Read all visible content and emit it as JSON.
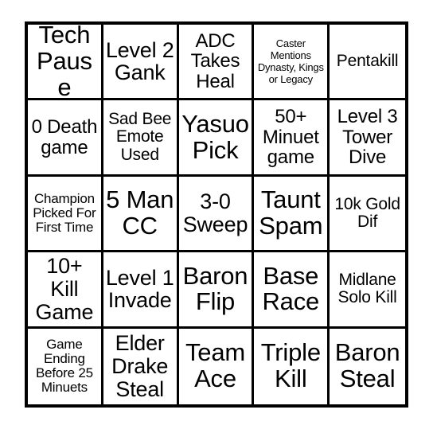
{
  "card": {
    "type": "bingo-card",
    "columns": 5,
    "rows": 5,
    "border_color": "#000000",
    "background_color": "#ffffff",
    "text_color": "#000000",
    "cells": [
      {
        "text": "Tech Pause",
        "size": "xxl"
      },
      {
        "text": "Level 2 Gank",
        "size": "xl"
      },
      {
        "text": "ADC Takes Heal",
        "size": "l"
      },
      {
        "text": "Caster Mentions Dynasty, Kings or Legacy",
        "size": "xs"
      },
      {
        "text": "Pentakill",
        "size": "m"
      },
      {
        "text": "0 Death game",
        "size": "l"
      },
      {
        "text": "Sad Bee Emote Used",
        "size": "m"
      },
      {
        "text": "Yasuo Pick",
        "size": "xxl"
      },
      {
        "text": "50+ Minuet game",
        "size": "l"
      },
      {
        "text": "Level 3 Tower Dive",
        "size": "l"
      },
      {
        "text": "Champion Picked For First Time",
        "size": "s"
      },
      {
        "text": "5 Man CC",
        "size": "xxl"
      },
      {
        "text": "3-0 Sweep",
        "size": "xl"
      },
      {
        "text": "Taunt Spam",
        "size": "xxl"
      },
      {
        "text": "10k Gold Dif",
        "size": "m"
      },
      {
        "text": "10+ Kill Game",
        "size": "xl"
      },
      {
        "text": "Level 1 Invade",
        "size": "xl"
      },
      {
        "text": "Baron Flip",
        "size": "xxl"
      },
      {
        "text": "Base Race",
        "size": "xxl"
      },
      {
        "text": "Midlane Solo Kill",
        "size": "m"
      },
      {
        "text": "Game Ending Before 25 Minuets",
        "size": "s"
      },
      {
        "text": "Elder Drake Steal",
        "size": "xl"
      },
      {
        "text": "Team Ace",
        "size": "xxl"
      },
      {
        "text": "Triple Kill",
        "size": "xxl"
      },
      {
        "text": "Baron Steal",
        "size": "xxl"
      }
    ]
  }
}
